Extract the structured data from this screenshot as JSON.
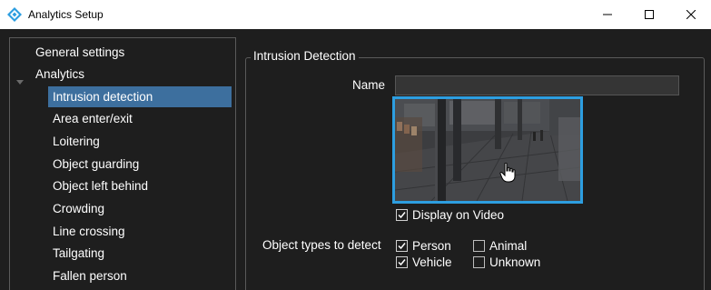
{
  "window": {
    "title": "Analytics Setup",
    "icon": "analytics-diamond-icon",
    "accent": "#2d9ee0"
  },
  "nav": {
    "items": [
      {
        "label": "General settings",
        "level": 1,
        "selected": false
      },
      {
        "label": "Analytics",
        "level": 1,
        "selected": false,
        "expanded": true
      },
      {
        "label": "Intrusion detection",
        "level": 2,
        "selected": true
      },
      {
        "label": "Area enter/exit",
        "level": 2,
        "selected": false
      },
      {
        "label": "Loitering",
        "level": 2,
        "selected": false
      },
      {
        "label": "Object guarding",
        "level": 2,
        "selected": false
      },
      {
        "label": "Object left behind",
        "level": 2,
        "selected": false
      },
      {
        "label": "Crowding",
        "level": 2,
        "selected": false
      },
      {
        "label": "Line crossing",
        "level": 2,
        "selected": false
      },
      {
        "label": "Tailgating",
        "level": 2,
        "selected": false
      },
      {
        "label": "Fallen person",
        "level": 2,
        "selected": false
      }
    ],
    "selected_color": "#3d6f9e"
  },
  "detail": {
    "group_title": "Intrusion Detection",
    "name_label": "Name",
    "name_value": "",
    "display_on_video": {
      "label": "Display on Video",
      "checked": true
    },
    "object_types_label": "Object types to detect",
    "object_types": [
      {
        "label": "Person",
        "checked": true
      },
      {
        "label": "Animal",
        "checked": false
      },
      {
        "label": "Vehicle",
        "checked": true
      },
      {
        "label": "Unknown",
        "checked": false
      }
    ]
  }
}
